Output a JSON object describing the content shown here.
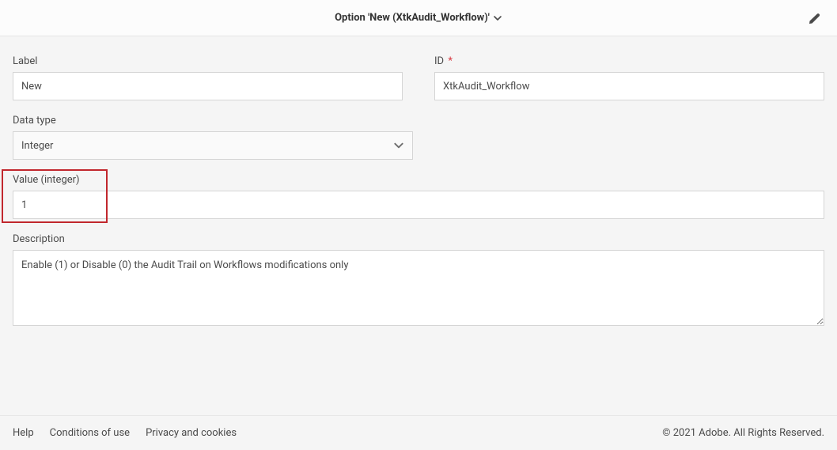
{
  "header": {
    "title": "Option 'New (XtkAudit_Workflow)'"
  },
  "form": {
    "label_field": {
      "label": "Label",
      "value": "New"
    },
    "id_field": {
      "label": "ID",
      "value": "XtkAudit_Workflow",
      "required": "*"
    },
    "datatype_field": {
      "label": "Data type",
      "value": "Integer"
    },
    "value_field": {
      "label": "Value (integer)",
      "value": "1"
    },
    "description_field": {
      "label": "Description",
      "value": "Enable (1) or Disable (0) the Audit Trail on Workflows modifications only"
    }
  },
  "footer": {
    "help": "Help",
    "conditions": "Conditions of use",
    "privacy": "Privacy and cookies",
    "copyright": "© 2021 Adobe. All Rights Reserved."
  }
}
